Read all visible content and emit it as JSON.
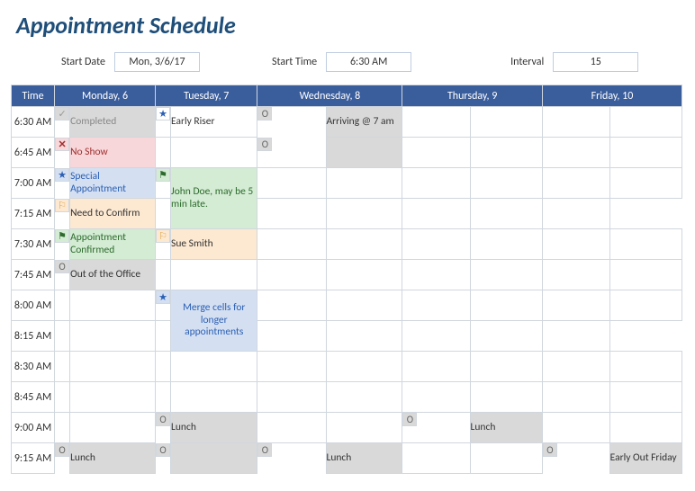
{
  "title": "Appointment Schedule",
  "controls": {
    "start_date_label": "Start Date",
    "start_date_value": "Mon, 3/6/17",
    "start_time_label": "Start Time",
    "start_time_value": "6:30 AM",
    "interval_label": "Interval",
    "interval_value": "15"
  },
  "headers": {
    "time": "Time",
    "days": [
      "Monday, 6",
      "Tuesday, 7",
      "Wednesday, 8",
      "Thursday, 9",
      "Friday, 10"
    ]
  },
  "times": [
    "6:30 AM",
    "6:45 AM",
    "7:00 AM",
    "7:15 AM",
    "7:30 AM",
    "7:45 AM",
    "8:00 AM",
    "8:15 AM",
    "8:30 AM",
    "8:45 AM",
    "9:00 AM",
    "9:15 AM"
  ],
  "cells": {
    "mon_630": "Completed",
    "mon_645": "No Show",
    "mon_700": "Special Appointment",
    "mon_715": "Need to Confirm",
    "mon_730": "Appointment Confirmed",
    "mon_745": "Out of the Office",
    "mon_915": "Lunch",
    "tue_630": "Early Riser",
    "tue_700": "John Doe, may be 5 min late.",
    "tue_730": "Sue Smith",
    "tue_800": "Merge cells for longer appointments",
    "tue_900": "Lunch",
    "wed_630": "Arriving @ 7 am",
    "wed_915": "Lunch",
    "thu_900": "Lunch",
    "fri_915": "Early Out Friday"
  }
}
